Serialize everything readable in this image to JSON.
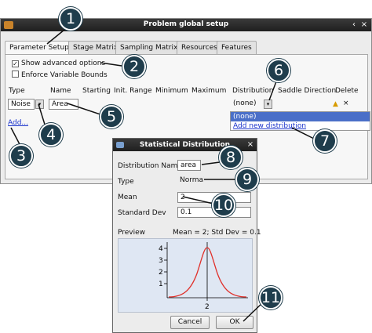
{
  "window": {
    "title": "Problem global setup"
  },
  "tabs": [
    "Parameter Setup",
    "Stage Matrix",
    "Sampling Matrix",
    "Resources",
    "Features"
  ],
  "options": {
    "show_advanced": "Show advanced options",
    "enforce_bounds": "Enforce Variable Bounds"
  },
  "columns": [
    "Type",
    "Name",
    "Starting",
    "Init. Range",
    "Minimum",
    "Maximum",
    "Distribution",
    "Saddle Direction",
    "Delete"
  ],
  "row": {
    "type": "Noise",
    "name": "Area",
    "distribution": "(none)",
    "delete_icon": "close-icon"
  },
  "add_link": "Add...",
  "distribution_dropdown": [
    "(none)",
    "Add new distribution"
  ],
  "dialog": {
    "title": "Statistical Distribution",
    "name_label": "Distribution Name",
    "name_value": "area",
    "type_label": "Type",
    "type_value": "Normal",
    "mean_label": "Mean",
    "mean_value": "2",
    "std_label": "Standard Dev",
    "std_value": "0.1",
    "preview_label": "Preview",
    "preview_stats": "Mean = 2; Std Dev = 0.1",
    "y_ticks": [
      "4",
      "3",
      "2",
      "1"
    ],
    "x_tick": "2",
    "cancel": "Cancel",
    "ok": "OK"
  },
  "callouts": [
    "1",
    "2",
    "3",
    "4",
    "5",
    "6",
    "7",
    "8",
    "9",
    "10",
    "11"
  ],
  "colors": {
    "callout": "#1f3d4c",
    "curve": "#e0302a",
    "link": "#1a33cc",
    "selection": "#4a6fc8"
  }
}
